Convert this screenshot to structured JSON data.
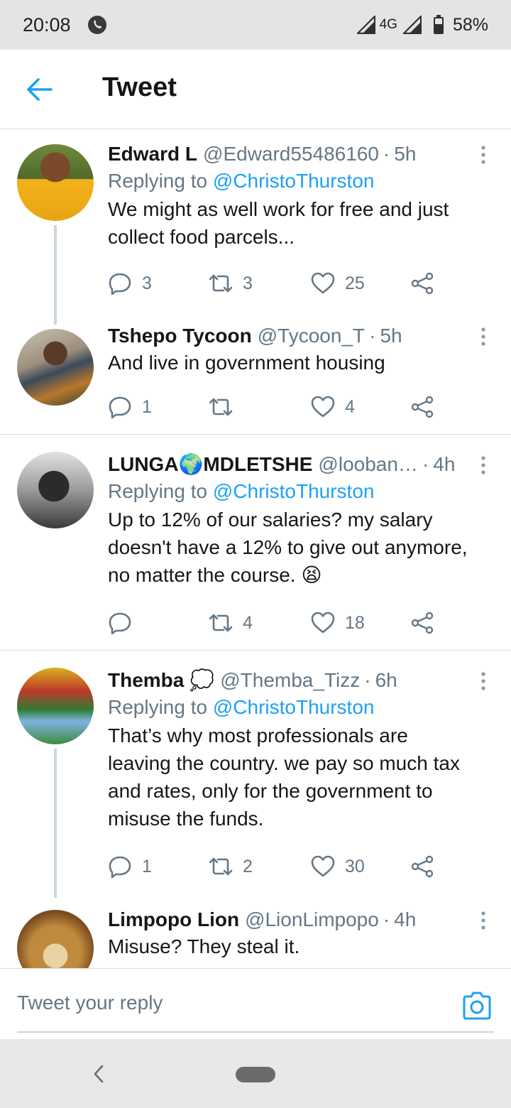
{
  "status_bar": {
    "time": "20:08",
    "network": "4G",
    "battery": "58%"
  },
  "header": {
    "title": "Tweet"
  },
  "tweets": [
    {
      "name": "Edward L",
      "handle": "@Edward55486160",
      "time": "5h",
      "replying_prefix": "Replying to",
      "replying_to": "@ChristoThurston",
      "lines": [
        "We might as well work for free and just",
        "collect food parcels..."
      ],
      "replies": "3",
      "retweets": "3",
      "likes": "25"
    },
    {
      "name": "Tshepo Tycoon",
      "handle": "@Tycoon_T",
      "time": "5h",
      "lines": [
        "And live in government housing"
      ],
      "replies": "1",
      "retweets": "",
      "likes": "4"
    },
    {
      "name_part1": "LUNGA",
      "name_emoji": "🌍",
      "name_part2": "MDLETSHE",
      "handle": "@looban…",
      "time": "4h",
      "replying_prefix": "Replying to",
      "replying_to": "@ChristoThurston",
      "lines": [
        "Up to 12% of our salaries?  my salary",
        "doesn't have a 12% to give out anymore,",
        "no matter the course."
      ],
      "emoji": "😫",
      "replies": "",
      "retweets": "4",
      "likes": "18"
    },
    {
      "name": "Themba",
      "name_emoji": "💭",
      "handle": "@Themba_Tizz",
      "time": "6h",
      "replying_prefix": "Replying to",
      "replying_to": "@ChristoThurston",
      "lines": [
        "That’s why most professionals are",
        "leaving the country. we pay so much tax",
        "and  rates,  only for the government to",
        "misuse the funds."
      ],
      "replies": "1",
      "retweets": "2",
      "likes": "30"
    },
    {
      "name": "Limpopo Lion",
      "handle": "@LionLimpopo",
      "time": "4h",
      "lines": [
        "Misuse? They steal it."
      ]
    }
  ],
  "reply_bar": {
    "placeholder": "Tweet your reply"
  },
  "colors": {
    "accent": "#1da1f2",
    "secondary_text": "#657786",
    "divider": "#d6dbe0"
  },
  "icons": [
    "whatsapp-icon",
    "signal-icon",
    "battery-icon",
    "back-arrow-icon",
    "more-icon",
    "reply-icon",
    "retweet-icon",
    "like-icon",
    "share-icon",
    "camera-icon"
  ]
}
